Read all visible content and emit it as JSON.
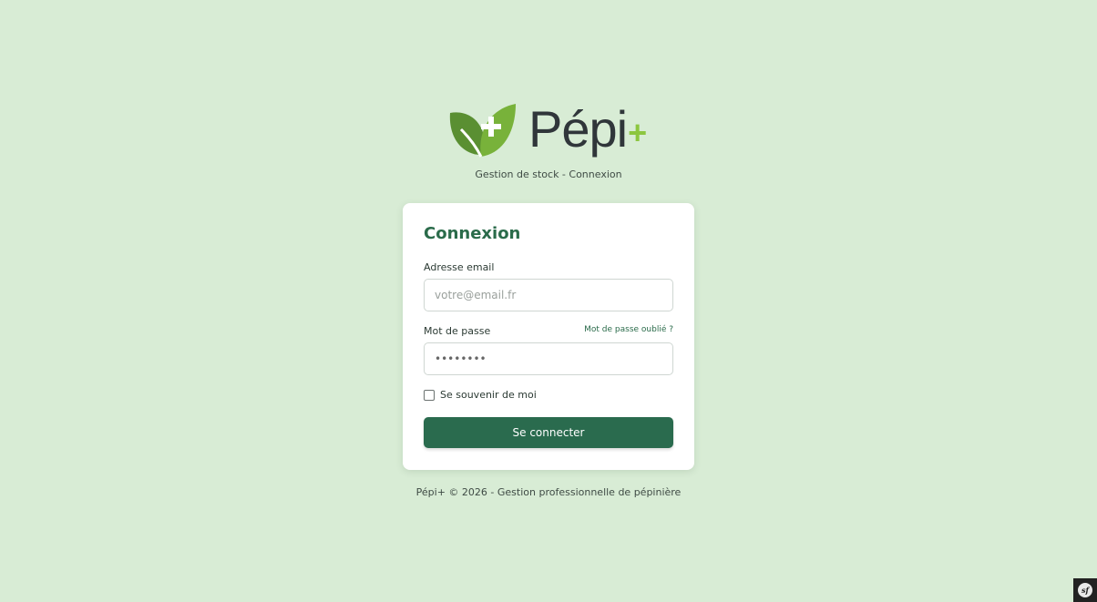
{
  "brand": {
    "name": "Pépi",
    "plus": "+",
    "subtitle": "Gestion de stock - Connexion",
    "colors": {
      "leaf_dark": "#5a8f32",
      "leaf_light": "#8cc63f",
      "text": "#30363a"
    }
  },
  "login": {
    "title": "Connexion",
    "email_label": "Adresse email",
    "email_placeholder": "votre@email.fr",
    "password_label": "Mot de passe",
    "forgot_link": "Mot de passe oublié ?",
    "password_value": "password",
    "remember_label": "Se souvenir de moi",
    "submit_label": "Se connecter"
  },
  "footer": {
    "text": "Pépi+ © 2026 - Gestion professionnelle de pépinière"
  },
  "colors": {
    "background": "#d8ecd5",
    "accent": "#2a6b4e",
    "card": "#ffffff"
  },
  "debug": {
    "icon": "symfony-icon",
    "label": "sf"
  }
}
